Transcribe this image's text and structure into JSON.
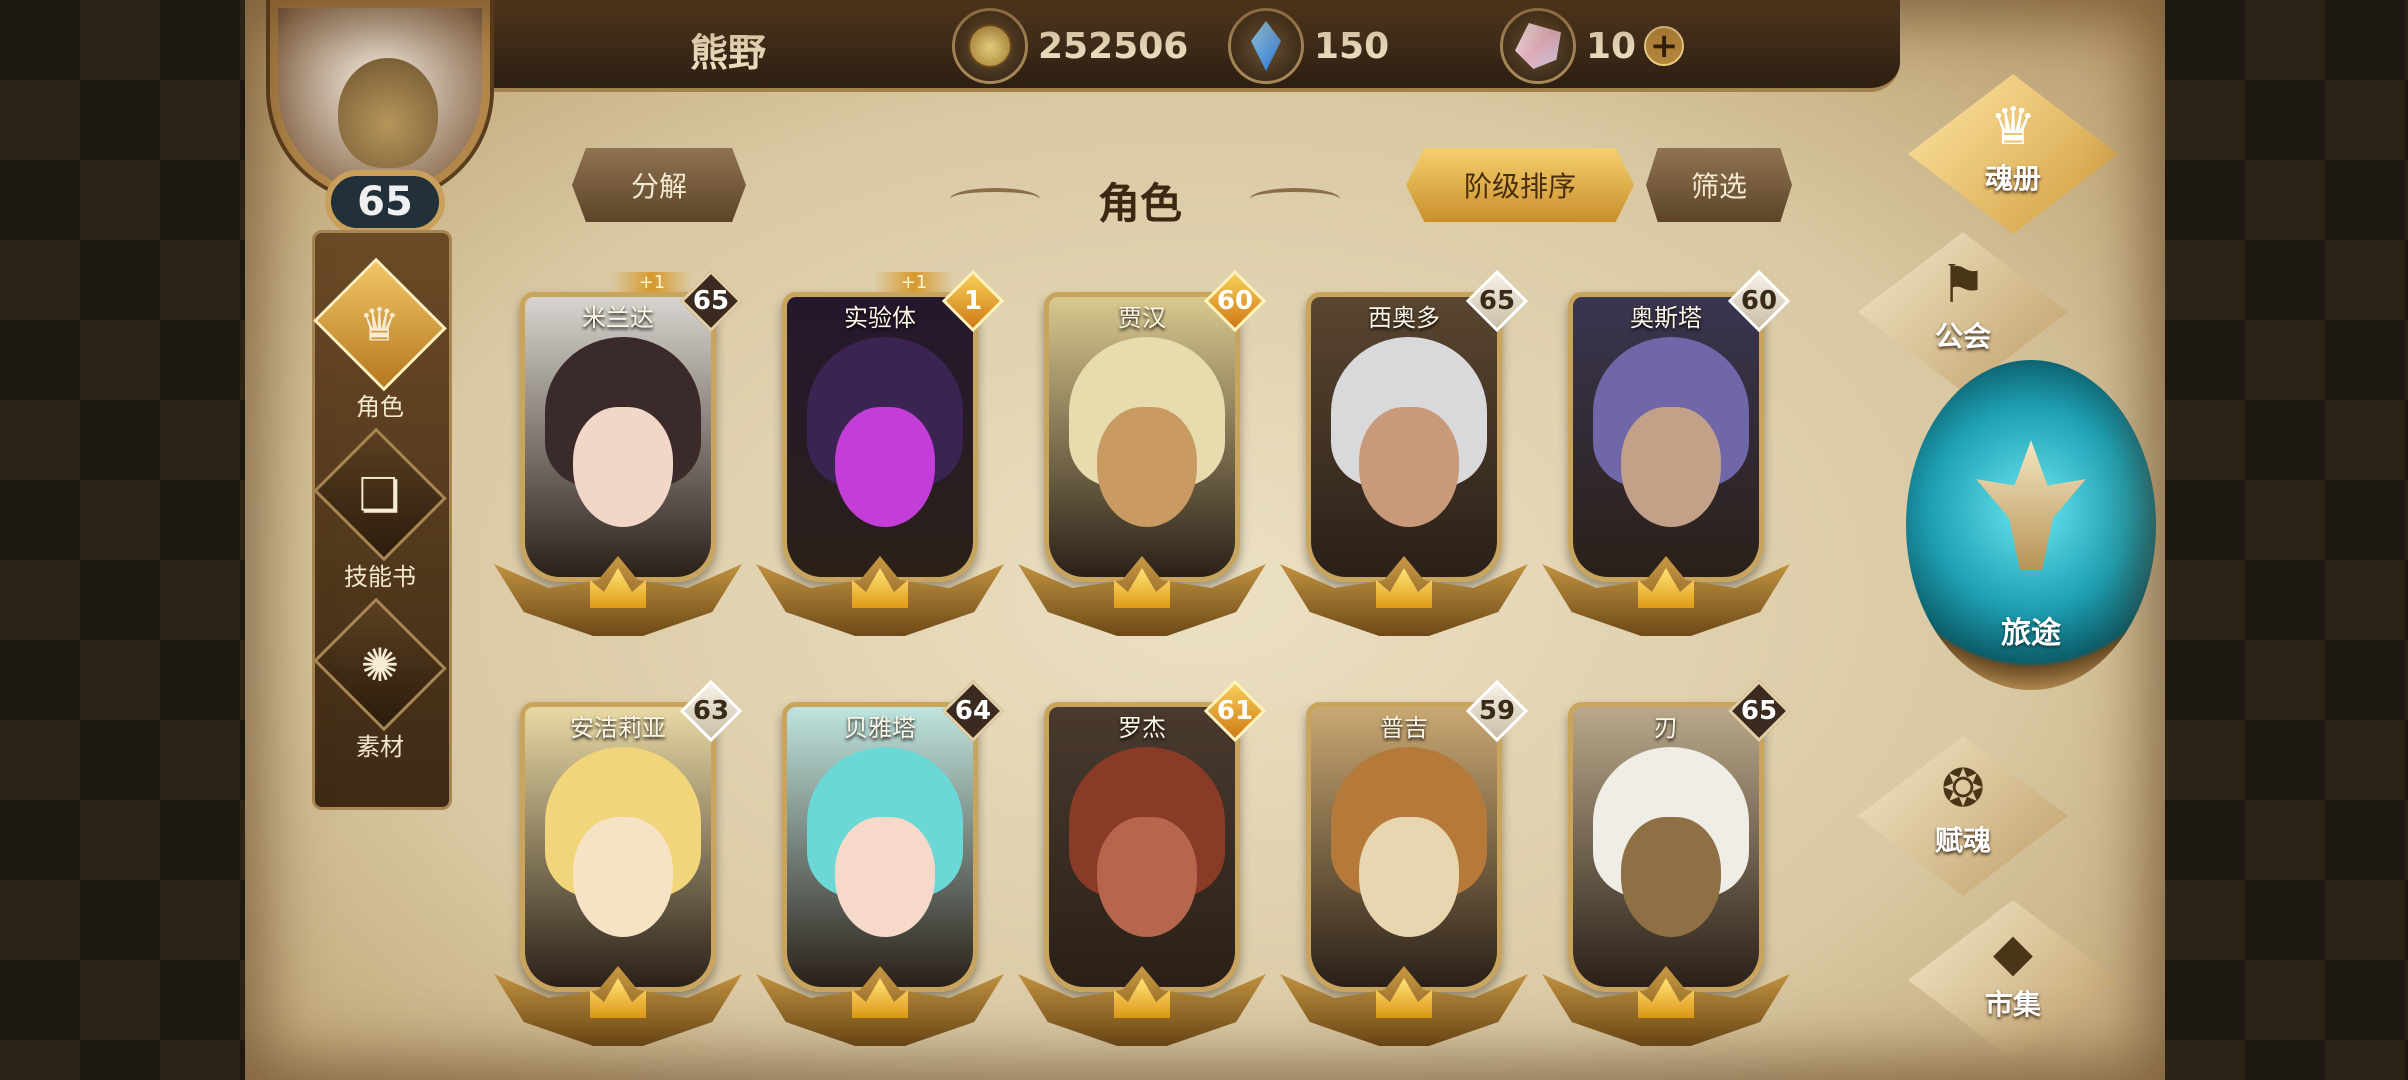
{
  "player": {
    "name": "熊野",
    "level": "65"
  },
  "resources": [
    {
      "icon": "gold-coin-icon",
      "value": "252506"
    },
    {
      "icon": "blue-gem-icon",
      "value": "150"
    },
    {
      "icon": "crystal-icon",
      "value": "10",
      "plus": "+"
    }
  ],
  "left_tabs": [
    {
      "label": "角色",
      "icon": "character-mask-icon",
      "active": true
    },
    {
      "label": "技能书",
      "icon": "skill-book-icon",
      "active": false
    },
    {
      "label": "素材",
      "icon": "material-icon",
      "active": false
    }
  ],
  "header": {
    "decompose_label": "分解",
    "title": "角色",
    "sort_label": "阶级排序",
    "filter_label": "筛选"
  },
  "heroes": [
    {
      "name": "米兰达",
      "level": "65",
      "badge": "dark",
      "plus": "+1",
      "hair": "#3a2a2a",
      "skin": "#f2d6c8",
      "bg": "#d9d4cf"
    },
    {
      "name": "实验体",
      "level": "1",
      "badge": "gold",
      "plus": "+1",
      "hair": "#3b2352",
      "skin": "#c23ed6",
      "bg": "#24182e"
    },
    {
      "name": "贾汉",
      "level": "60",
      "badge": "gold",
      "plus": "",
      "hair": "#e7dcae",
      "skin": "#c99a62",
      "bg": "#d9c88e"
    },
    {
      "name": "西奥多",
      "level": "65",
      "badge": "white",
      "plus": "",
      "hair": "#d9d9dc",
      "skin": "#c99a7a",
      "bg": "#5a4630"
    },
    {
      "name": "奥斯塔",
      "level": "60",
      "badge": "white",
      "plus": "",
      "hair": "#6f67a8",
      "skin": "#c3a088",
      "bg": "#3a3550"
    },
    {
      "name": "安洁莉亚",
      "level": "63",
      "badge": "white",
      "plus": "",
      "hair": "#f1d57a",
      "skin": "#f6e2c4",
      "bg": "#e8d9a4"
    },
    {
      "name": "贝雅塔",
      "level": "64",
      "badge": "dark",
      "plus": "",
      "hair": "#6cd8d6",
      "skin": "#f6d9c8",
      "bg": "#bfe4de"
    },
    {
      "name": "罗杰",
      "level": "61",
      "badge": "gold",
      "plus": "",
      "hair": "#8a3b28",
      "skin": "#b5664c",
      "bg": "#4a3a2e"
    },
    {
      "name": "普吉",
      "level": "59",
      "badge": "white",
      "plus": "",
      "hair": "#b57a3a",
      "skin": "#e8d6b0",
      "bg": "#c9a872"
    },
    {
      "name": "刃",
      "level": "65",
      "badge": "dark",
      "plus": "",
      "hair": "#f0ede6",
      "skin": "#8f6f44",
      "bg": "#b9a88a"
    }
  ],
  "right_nav": [
    {
      "label": "魂册",
      "icon": "soul-book-icon",
      "active": true
    },
    {
      "label": "公会",
      "icon": "guild-icon",
      "active": false
    },
    {
      "label": "旅途",
      "icon": "journey-emblem-icon",
      "active": false
    },
    {
      "label": "赋魂",
      "icon": "ensoul-icon",
      "active": false
    },
    {
      "label": "市集",
      "icon": "market-icon",
      "active": false
    }
  ]
}
